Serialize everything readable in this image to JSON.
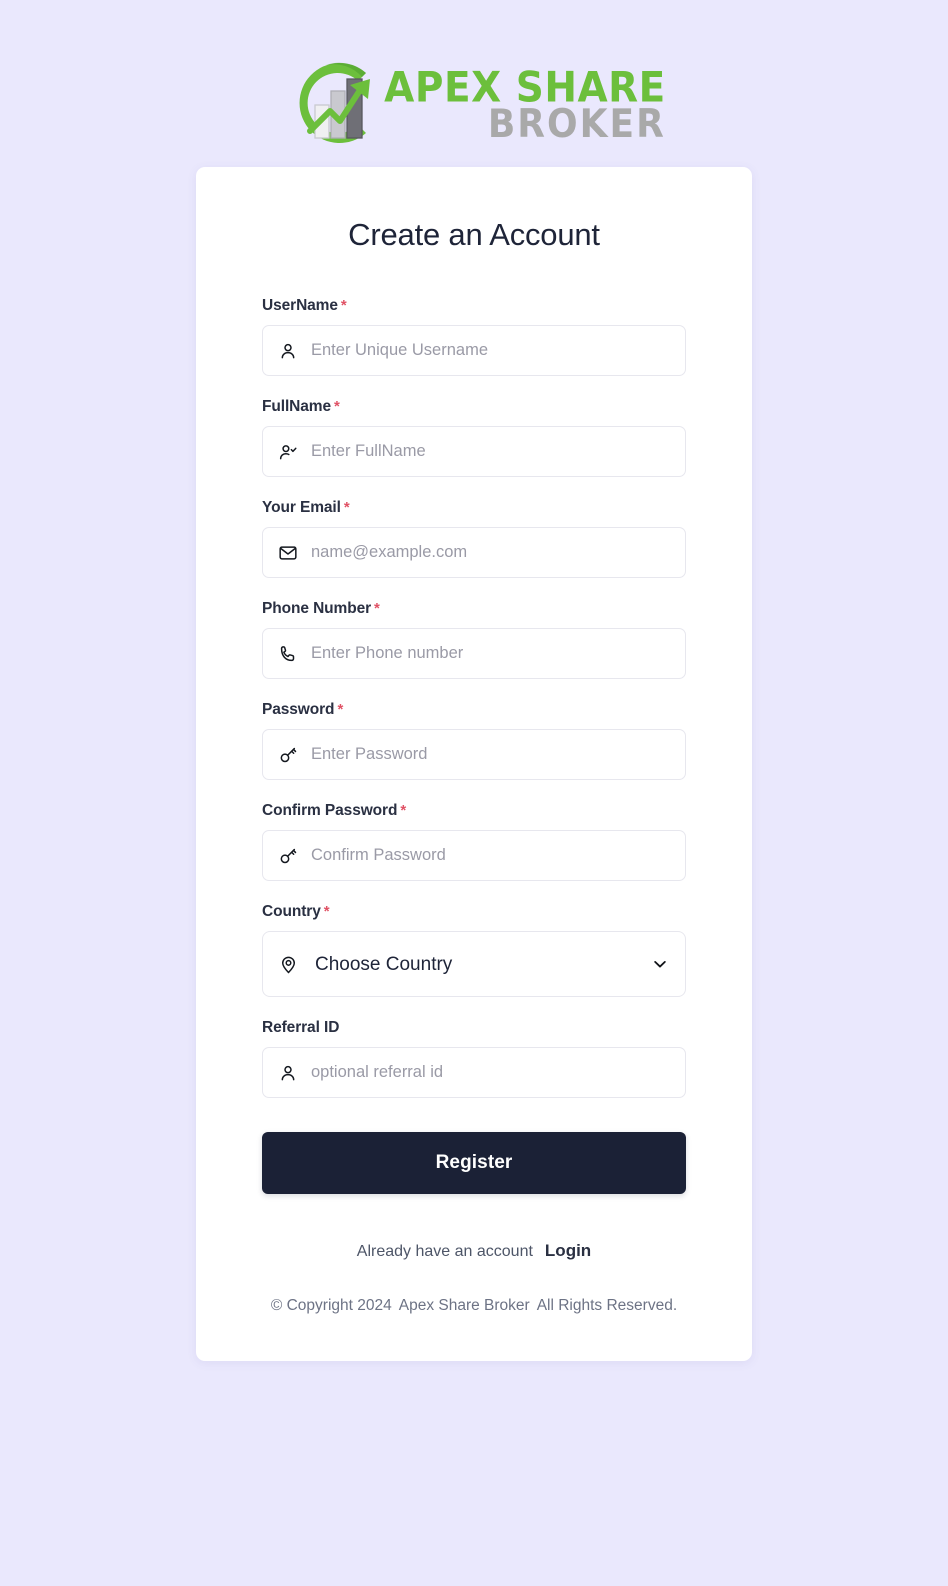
{
  "brand": {
    "logo_line1": "APEX SHARE",
    "logo_line2": "BROKER",
    "logo_mark_name": "apex-share-broker-logo",
    "green": "#6cbf3c",
    "gray": "#a9a9a9"
  },
  "card": {
    "title": "Create an Account"
  },
  "colors": {
    "page_background": "#eae8fd",
    "card_background": "#ffffff",
    "required_asterisk": "#e05265",
    "button_background": "#1b2136",
    "button_text": "#ffffff",
    "label_text": "#2a3042",
    "placeholder_text": "#9a9aa6",
    "input_border": "#e7e7ee"
  },
  "form": {
    "required_marker": "*",
    "fields": [
      {
        "key": "username",
        "label": "UserName",
        "required": true,
        "placeholder": "Enter Unique Username",
        "value": "",
        "icon": "user-icon",
        "type": "text"
      },
      {
        "key": "fullname",
        "label": "FullName",
        "required": true,
        "placeholder": "Enter FullName",
        "value": "",
        "icon": "user-check-icon",
        "type": "text"
      },
      {
        "key": "email",
        "label": "Your Email",
        "required": true,
        "placeholder": "name@example.com",
        "value": "",
        "icon": "envelope-icon",
        "type": "email"
      },
      {
        "key": "phone",
        "label": "Phone Number",
        "required": true,
        "placeholder": "Enter Phone number",
        "value": "",
        "icon": "phone-icon",
        "type": "tel"
      },
      {
        "key": "password",
        "label": "Password",
        "required": true,
        "placeholder": "Enter Password",
        "value": "",
        "icon": "key-icon",
        "type": "password"
      },
      {
        "key": "confirm_password",
        "label": "Confirm Password",
        "required": true,
        "placeholder": "Confirm Password",
        "value": "",
        "icon": "key-icon",
        "type": "password"
      },
      {
        "key": "referral",
        "label": "Referral ID",
        "required": false,
        "placeholder": "optional referral id",
        "value": "",
        "icon": "user-icon",
        "type": "text"
      }
    ],
    "country": {
      "key": "country",
      "label": "Country",
      "required": true,
      "selected": "Choose Country",
      "icon": "map-pin-icon",
      "chevron_icon": "chevron-down-icon",
      "options": [
        "Choose Country"
      ]
    },
    "submit_label": "Register"
  },
  "footer": {
    "have_account_text": "Already have an account",
    "login_label": "Login",
    "copyright_1": "© Copyright 2024",
    "copyright_2": "Apex Share Broker",
    "copyright_3": "All Rights Reserved."
  }
}
